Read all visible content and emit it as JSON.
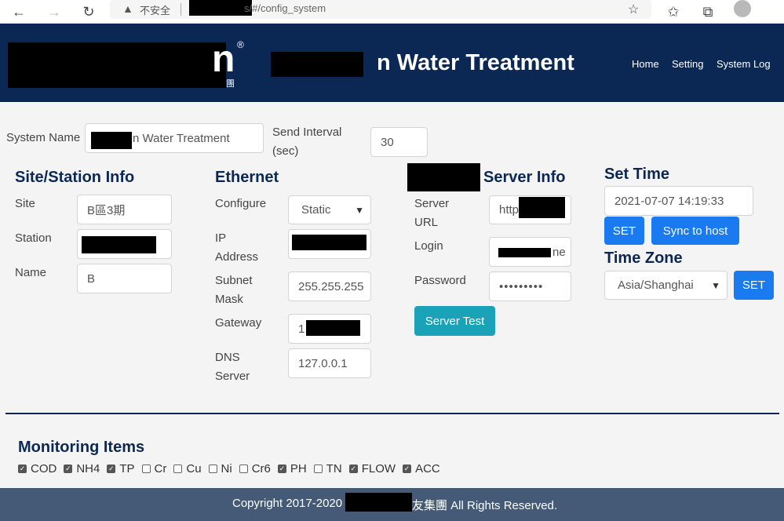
{
  "browser": {
    "insecure_label": "不安全",
    "url_suffix": "s/#/config_system",
    "back_icon": "arrow-left-icon",
    "forward_icon": "arrow-right-icon",
    "reload_icon": "reload-icon"
  },
  "header": {
    "title_suffix": "n Water Treatment",
    "logo_tail": "n",
    "logo_reg": "®",
    "logo_sub": "團",
    "nav": [
      "Home",
      "Setting",
      "System Log"
    ],
    "bg_color": "#0b2855"
  },
  "system": {
    "name_label": "System Name",
    "name_value": "n Water Treatment",
    "interval_label_1": "Send Interval",
    "interval_label_2": "(sec)",
    "interval_value": "30"
  },
  "site": {
    "heading": "Site/Station Info",
    "site_label": "Site",
    "site_value": "B區3期",
    "station_label": "Station",
    "name_label": "Name",
    "name_value": "B"
  },
  "ethernet": {
    "heading": "Ethernet",
    "configure_label": "Configure",
    "configure_value": "Static",
    "ip_label_1": "IP",
    "ip_label_2": "Address",
    "subnet_label_1": "Subnet",
    "subnet_label_2": "Mask",
    "subnet_value": "255.255.255",
    "gateway_label": "Gateway",
    "gateway_value": "1",
    "dns_label_1": "DNS",
    "dns_label_2": "Server",
    "dns_value": "127.0.0.1"
  },
  "server": {
    "heading": "Server Info",
    "url_label_1": "Server",
    "url_label_2": "URL",
    "url_value": "http",
    "login_label": "Login",
    "login_value": "ne",
    "password_label": "Password",
    "password_value": "•••••••••",
    "test_button": "Server Test"
  },
  "time": {
    "heading": "Set Time",
    "datetime_value": "2021-07-07 14:19:33",
    "set_button": "SET",
    "sync_button": "Sync to host",
    "zone_heading": "Time Zone",
    "zone_value": "Asia/Shanghai",
    "zone_set_button": "SET"
  },
  "monitoring": {
    "heading": "Monitoring Items",
    "items": [
      {
        "label": "COD",
        "checked": true
      },
      {
        "label": "NH4",
        "checked": true
      },
      {
        "label": "TP",
        "checked": true
      },
      {
        "label": "Cr",
        "checked": false
      },
      {
        "label": "Cu",
        "checked": false
      },
      {
        "label": "Ni",
        "checked": false
      },
      {
        "label": "Cr6",
        "checked": false
      },
      {
        "label": "PH",
        "checked": true
      },
      {
        "label": "TN",
        "checked": false
      },
      {
        "label": "FLOW",
        "checked": true
      },
      {
        "label": "ACC",
        "checked": true
      }
    ]
  },
  "footer": {
    "copyright_prefix": "Copyright 2017-2020",
    "copyright_suffix": "友集團 All Rights Reserved."
  }
}
